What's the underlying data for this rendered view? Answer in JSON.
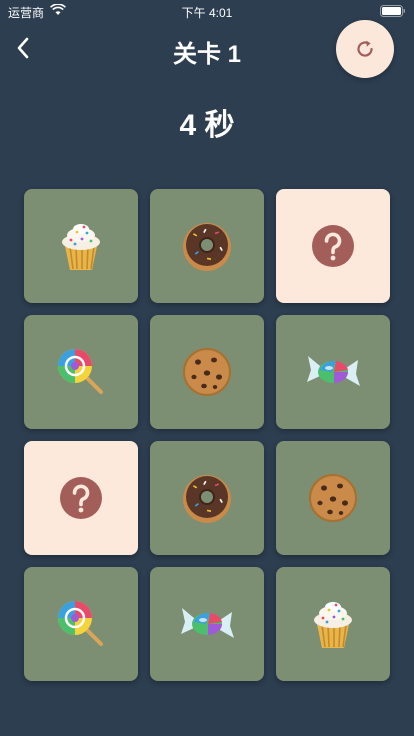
{
  "status_bar": {
    "carrier": "运营商",
    "time": "下午 4:01"
  },
  "header": {
    "title": "关卡 1",
    "back_icon": "chevron-left-icon",
    "reset_icon": "refresh-icon"
  },
  "timer": {
    "text": "4 秒"
  },
  "colors": {
    "background": "#2d3e50",
    "card_face": "#7d8f72",
    "card_hidden": "#fce9dc",
    "question_circle": "#a45e5a"
  },
  "board": {
    "cards": [
      {
        "state": "revealed",
        "icon": "cupcake-icon"
      },
      {
        "state": "revealed",
        "icon": "donut-icon"
      },
      {
        "state": "hidden",
        "icon": "question-icon"
      },
      {
        "state": "revealed",
        "icon": "lollipop-icon"
      },
      {
        "state": "revealed",
        "icon": "cookie-icon"
      },
      {
        "state": "revealed",
        "icon": "candy-icon"
      },
      {
        "state": "hidden",
        "icon": "question-icon"
      },
      {
        "state": "revealed",
        "icon": "donut-icon"
      },
      {
        "state": "revealed",
        "icon": "cookie-icon"
      },
      {
        "state": "revealed",
        "icon": "lollipop-icon"
      },
      {
        "state": "revealed",
        "icon": "candy-icon"
      },
      {
        "state": "revealed",
        "icon": "cupcake-icon"
      }
    ]
  }
}
